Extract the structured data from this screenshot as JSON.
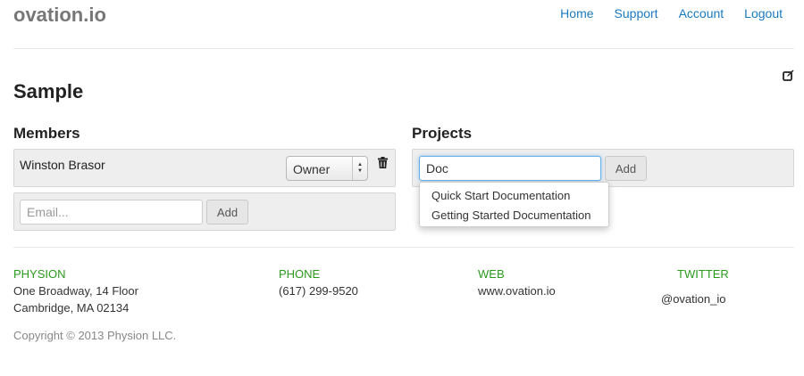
{
  "header": {
    "brand": "ovation.io",
    "nav": [
      "Home",
      "Support",
      "Account",
      "Logout"
    ]
  },
  "page": {
    "title": "Sample"
  },
  "members": {
    "heading": "Members",
    "items": [
      {
        "name": "Winston Brasor",
        "role": "Owner"
      }
    ],
    "email_placeholder": "Email...",
    "add_label": "Add"
  },
  "projects": {
    "heading": "Projects",
    "input_value": "Doc",
    "add_label": "Add",
    "suggestions": [
      "Quick Start Documentation",
      "Getting Started Documentation"
    ]
  },
  "footer": {
    "physion": {
      "heading": "PHYSION",
      "lines": [
        "One Broadway, 14 Floor",
        "Cambridge, MA 02134"
      ]
    },
    "phone": {
      "heading": "PHONE",
      "value": "(617) 299-9520"
    },
    "web": {
      "heading": "WEB",
      "value": "www.ovation.io"
    },
    "twitter": {
      "heading": "TWITTER",
      "value": "@ovation_io"
    },
    "copyright": "Copyright © 2013 Physion LLC."
  },
  "icons": {
    "edit": "edit-icon",
    "trash": "trash-icon",
    "select_arrows": "chevron-up-down-icon"
  },
  "colors": {
    "link": "#1a7abf",
    "footer_heading": "#2b9a1d",
    "well_bg": "#eeeeee",
    "focus_border": "#66afe9"
  }
}
